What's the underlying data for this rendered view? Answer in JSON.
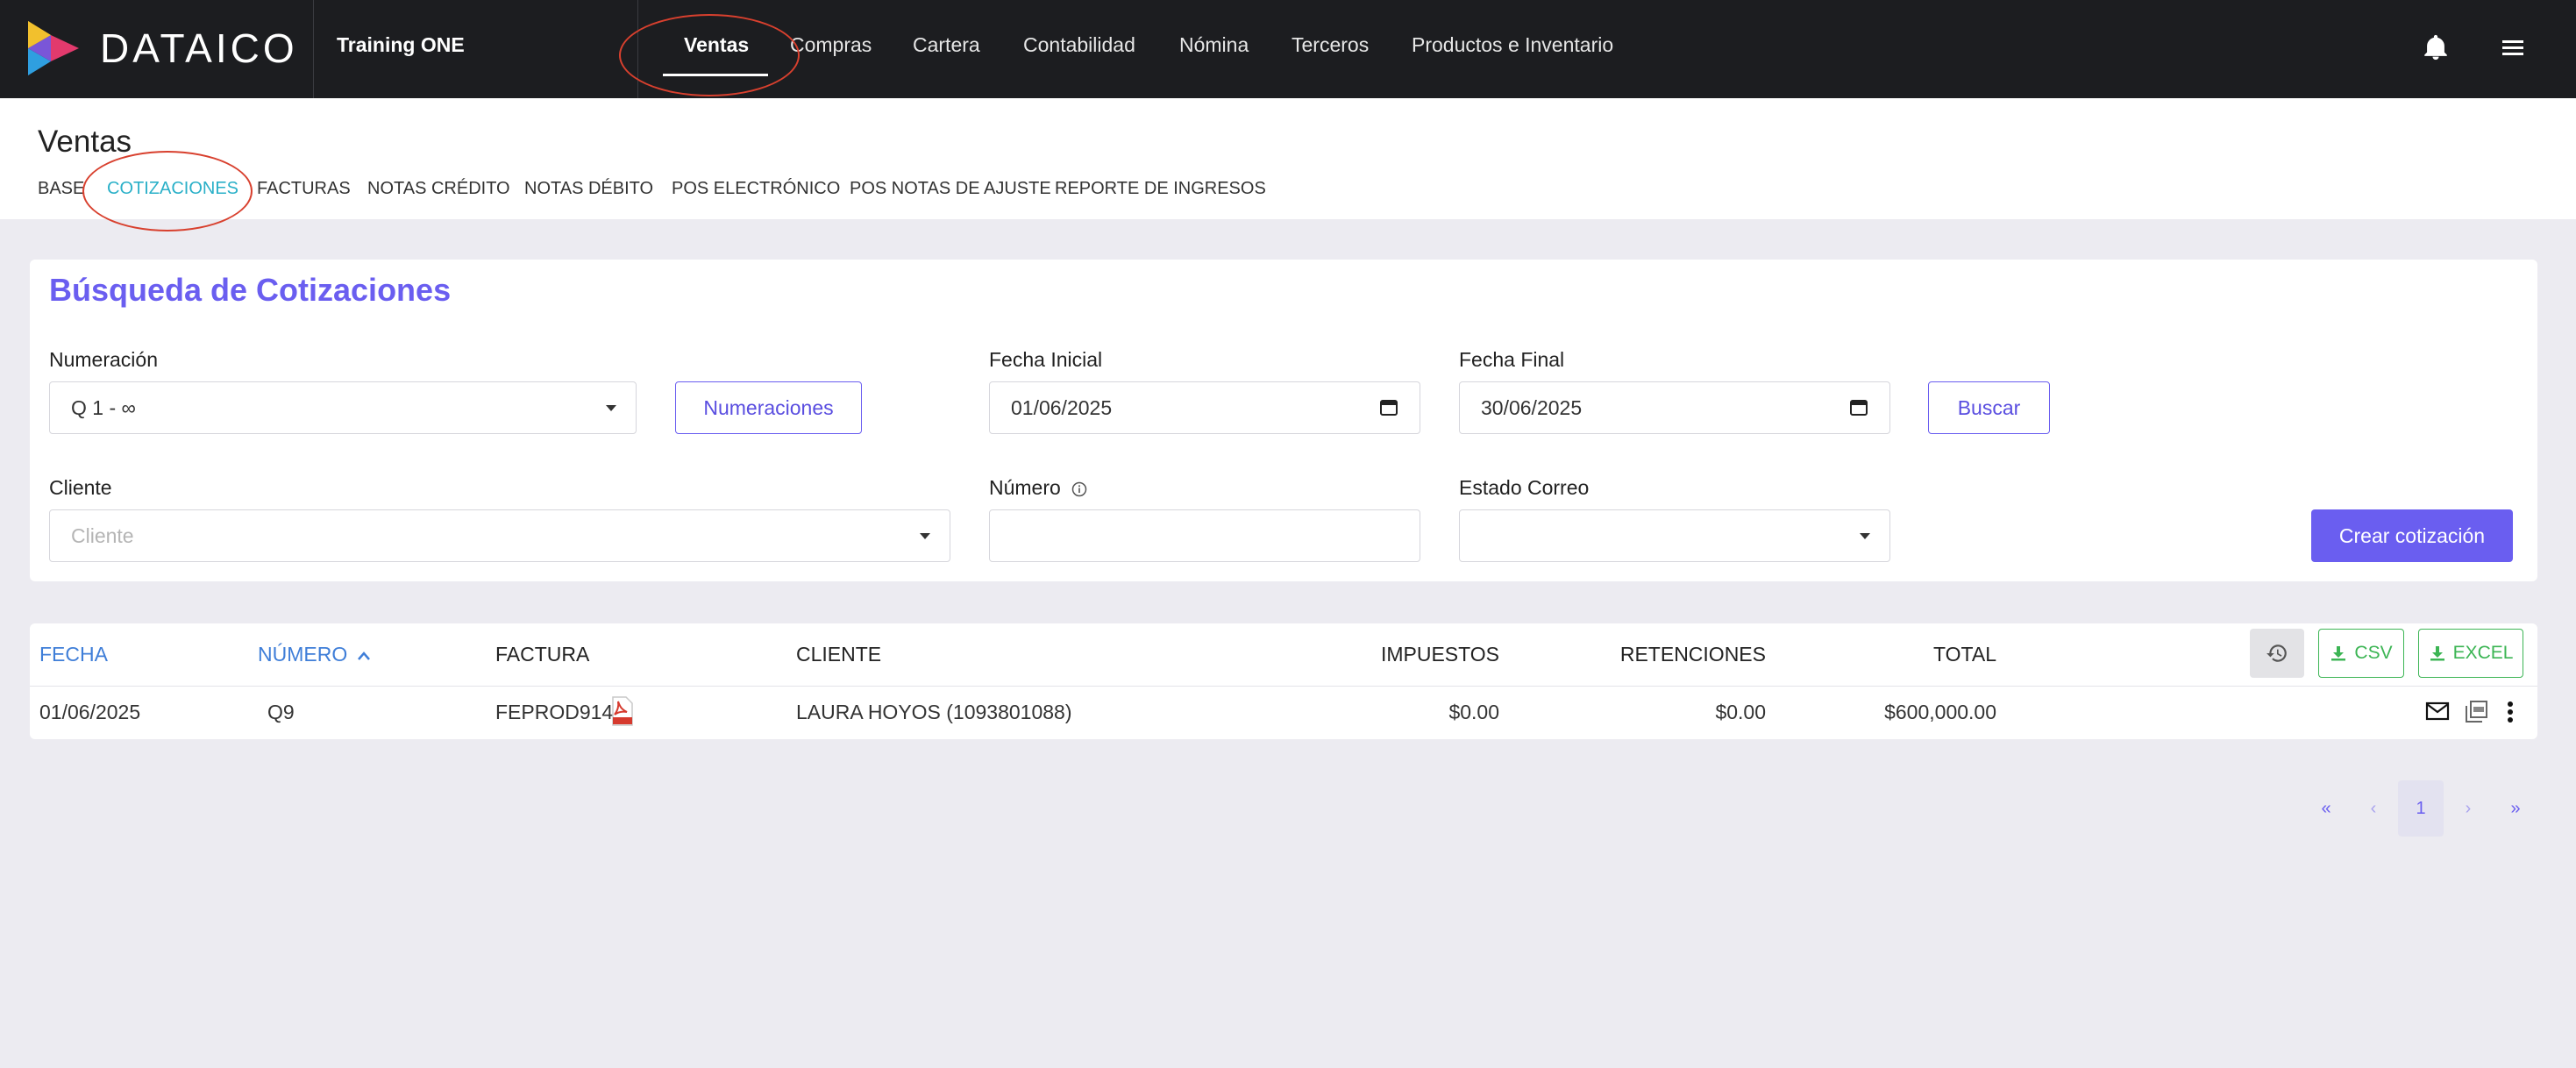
{
  "brand": {
    "name": "DATAICO",
    "company": "Training ONE"
  },
  "topnav": {
    "items": [
      "Ventas",
      "Compras",
      "Cartera",
      "Contabilidad",
      "Nómina",
      "Terceros",
      "Productos e Inventario"
    ],
    "active": "Ventas"
  },
  "page": {
    "title": "Ventas",
    "tabs": [
      "BASE",
      "COTIZACIONES",
      "FACTURAS",
      "NOTAS CRÉDITO",
      "NOTAS DÉBITO",
      "POS ELECTRÓNICO",
      "POS NOTAS DE AJUSTE",
      "REPORTE DE INGRESOS"
    ],
    "active_tab": "COTIZACIONES"
  },
  "search": {
    "title": "Búsqueda de Cotizaciones",
    "numeracion_label": "Numeración",
    "numeracion_value": "Q 1 - ∞",
    "numeraciones_button": "Numeraciones",
    "fecha_inicial_label": "Fecha Inicial",
    "fecha_inicial_value": "01/06/2025",
    "fecha_final_label": "Fecha Final",
    "fecha_final_value": "30/06/2025",
    "buscar_button": "Buscar",
    "cliente_label": "Cliente",
    "cliente_placeholder": "Cliente",
    "numero_label": "Número",
    "numero_value": "",
    "estado_label": "Estado Correo",
    "estado_value": "",
    "crear_button": "Crear cotización"
  },
  "table": {
    "headers": {
      "fecha": "FECHA",
      "numero": "NÚMERO",
      "factura": "FACTURA",
      "cliente": "CLIENTE",
      "impuestos": "IMPUESTOS",
      "retenciones": "RETENCIONES",
      "total": "TOTAL"
    },
    "csv_button": "CSV",
    "excel_button": "EXCEL",
    "rows": [
      {
        "fecha": "01/06/2025",
        "numero": "Q9",
        "factura": "FEPROD914",
        "cliente": "LAURA HOYOS (1093801088)",
        "impuestos": "$0.00",
        "retenciones": "$0.00",
        "total": "$600,000.00"
      }
    ]
  },
  "pagination": {
    "first": "«",
    "prev": "‹",
    "current": "1",
    "next": "›",
    "last": "»"
  },
  "colors": {
    "accent": "#6a5ef0",
    "active_tab": "#2ab0c8",
    "link": "#3f7ed8",
    "success": "#3cb554",
    "annotation": "#d8402e"
  }
}
